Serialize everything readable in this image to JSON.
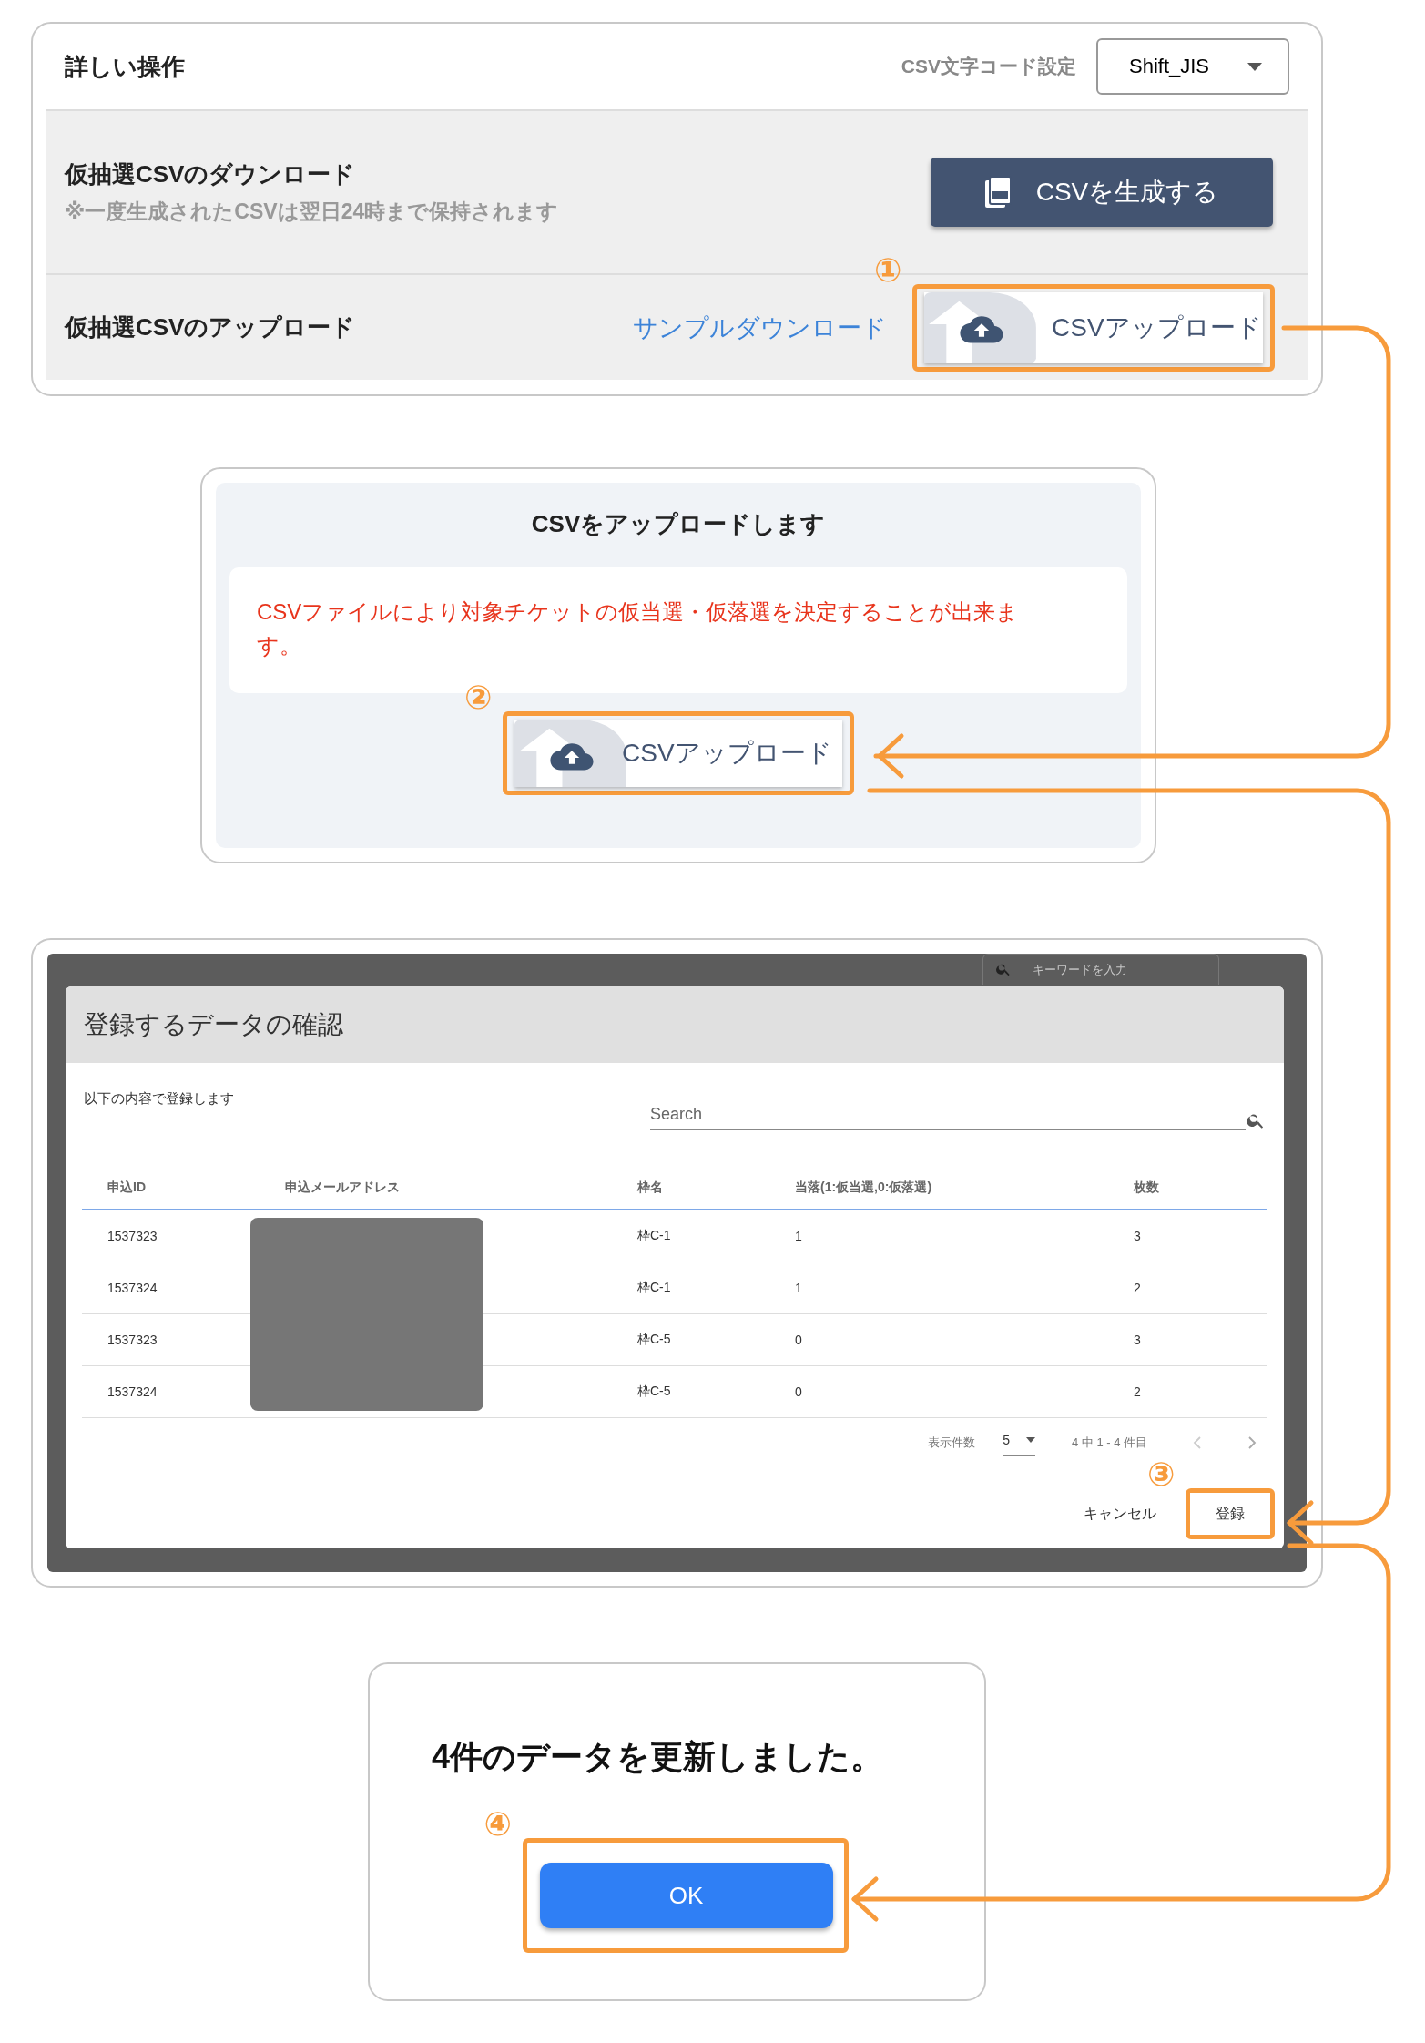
{
  "advanced_panel": {
    "title": "詳しい操作",
    "encoding_label": "CSV文字コード設定",
    "encoding_select": {
      "value": "Shift_JIS"
    },
    "download_row": {
      "title": "仮抽選CSVのダウンロード",
      "note": "※一度生成されたCSVは翌日24時まで保持されます",
      "button": "CSVを生成する"
    },
    "upload_row": {
      "title": "仮抽選CSVのアップロード",
      "link": "サンプルダウンロード",
      "button": "CSVアップロード",
      "step": "①"
    }
  },
  "upload_dialog": {
    "title": "CSVをアップロードします",
    "message": "CSVファイルにより対象チケットの仮当選・仮落選を決定することが出来ます。",
    "button": "CSVアップロード",
    "step": "②"
  },
  "confirm_dialog": {
    "backdrop_search_placeholder": "キーワードを入力",
    "title": "登録するデータの確認",
    "subtitle": "以下の内容で登録します",
    "search": {
      "placeholder": "Search"
    },
    "columns": [
      "申込ID",
      "申込メールアドレス",
      "枠名",
      "当落(1:仮当選,0:仮落選)",
      "枚数"
    ],
    "email_redacted": true,
    "rows": [
      {
        "id": "1537323",
        "frame": "枠C-1",
        "result": "1",
        "count": "3"
      },
      {
        "id": "1537324",
        "frame": "枠C-1",
        "result": "1",
        "count": "2"
      },
      {
        "id": "1537323",
        "frame": "枠C-5",
        "result": "0",
        "count": "3"
      },
      {
        "id": "1537324",
        "frame": "枠C-5",
        "result": "0",
        "count": "2"
      }
    ],
    "pagination": {
      "rows_per_page_label": "表示件数",
      "rows_per_page": "5",
      "range": "4 中 1 - 4 件目"
    },
    "cancel_button": "キャンセル",
    "submit_button": "登録",
    "step": "③"
  },
  "result_dialog": {
    "message": "4件のデータを更新しました。",
    "ok_button": "OK",
    "step": "④"
  }
}
